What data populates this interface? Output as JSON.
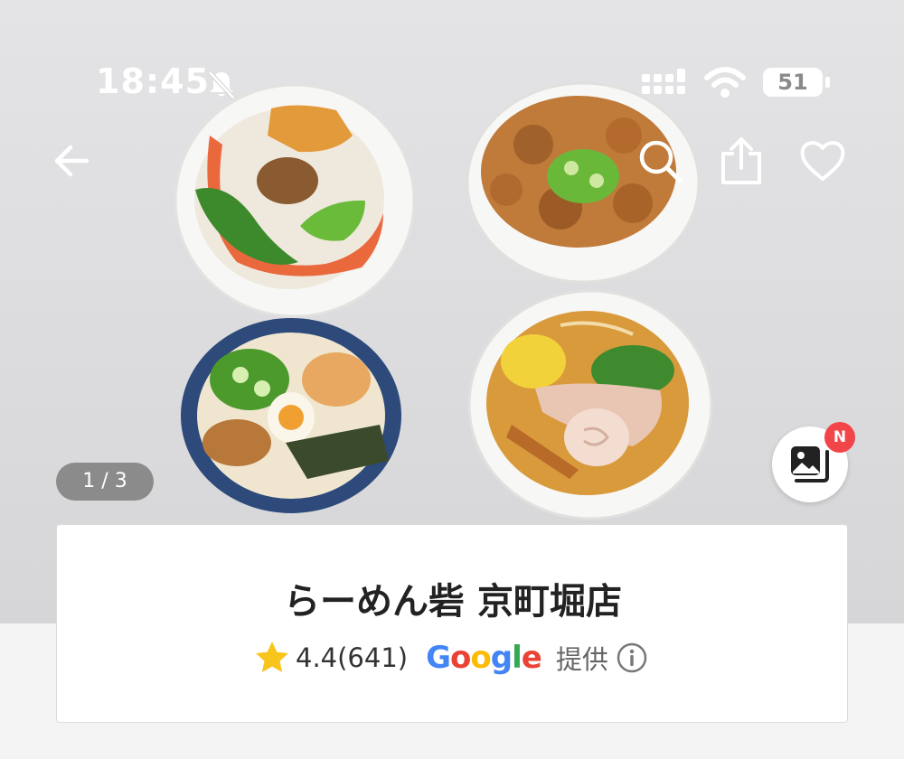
{
  "status_bar": {
    "time": "18:45",
    "battery": "51",
    "icons": [
      "bell-slash-icon",
      "signal-icon",
      "wifi-icon",
      "battery-icon"
    ]
  },
  "nav": {
    "icons": [
      "back-arrow-icon",
      "search-icon",
      "share-icon",
      "heart-icon"
    ]
  },
  "photo": {
    "counter": "1 / 3",
    "gallery_badge": "N",
    "gallery_icon": "photo-gallery-icon"
  },
  "shop": {
    "name": "らーめん砦 京町堀店",
    "rating": "4.4(641)",
    "provider": "Google",
    "provided_label": "提供",
    "info_icon": "info-icon",
    "star_color": "#f7c51b"
  },
  "colors": {
    "badge": "#f2454a",
    "google_blue": "#4285F4",
    "google_red": "#EA4335",
    "google_yellow": "#FBBC05",
    "google_green": "#34A853"
  }
}
